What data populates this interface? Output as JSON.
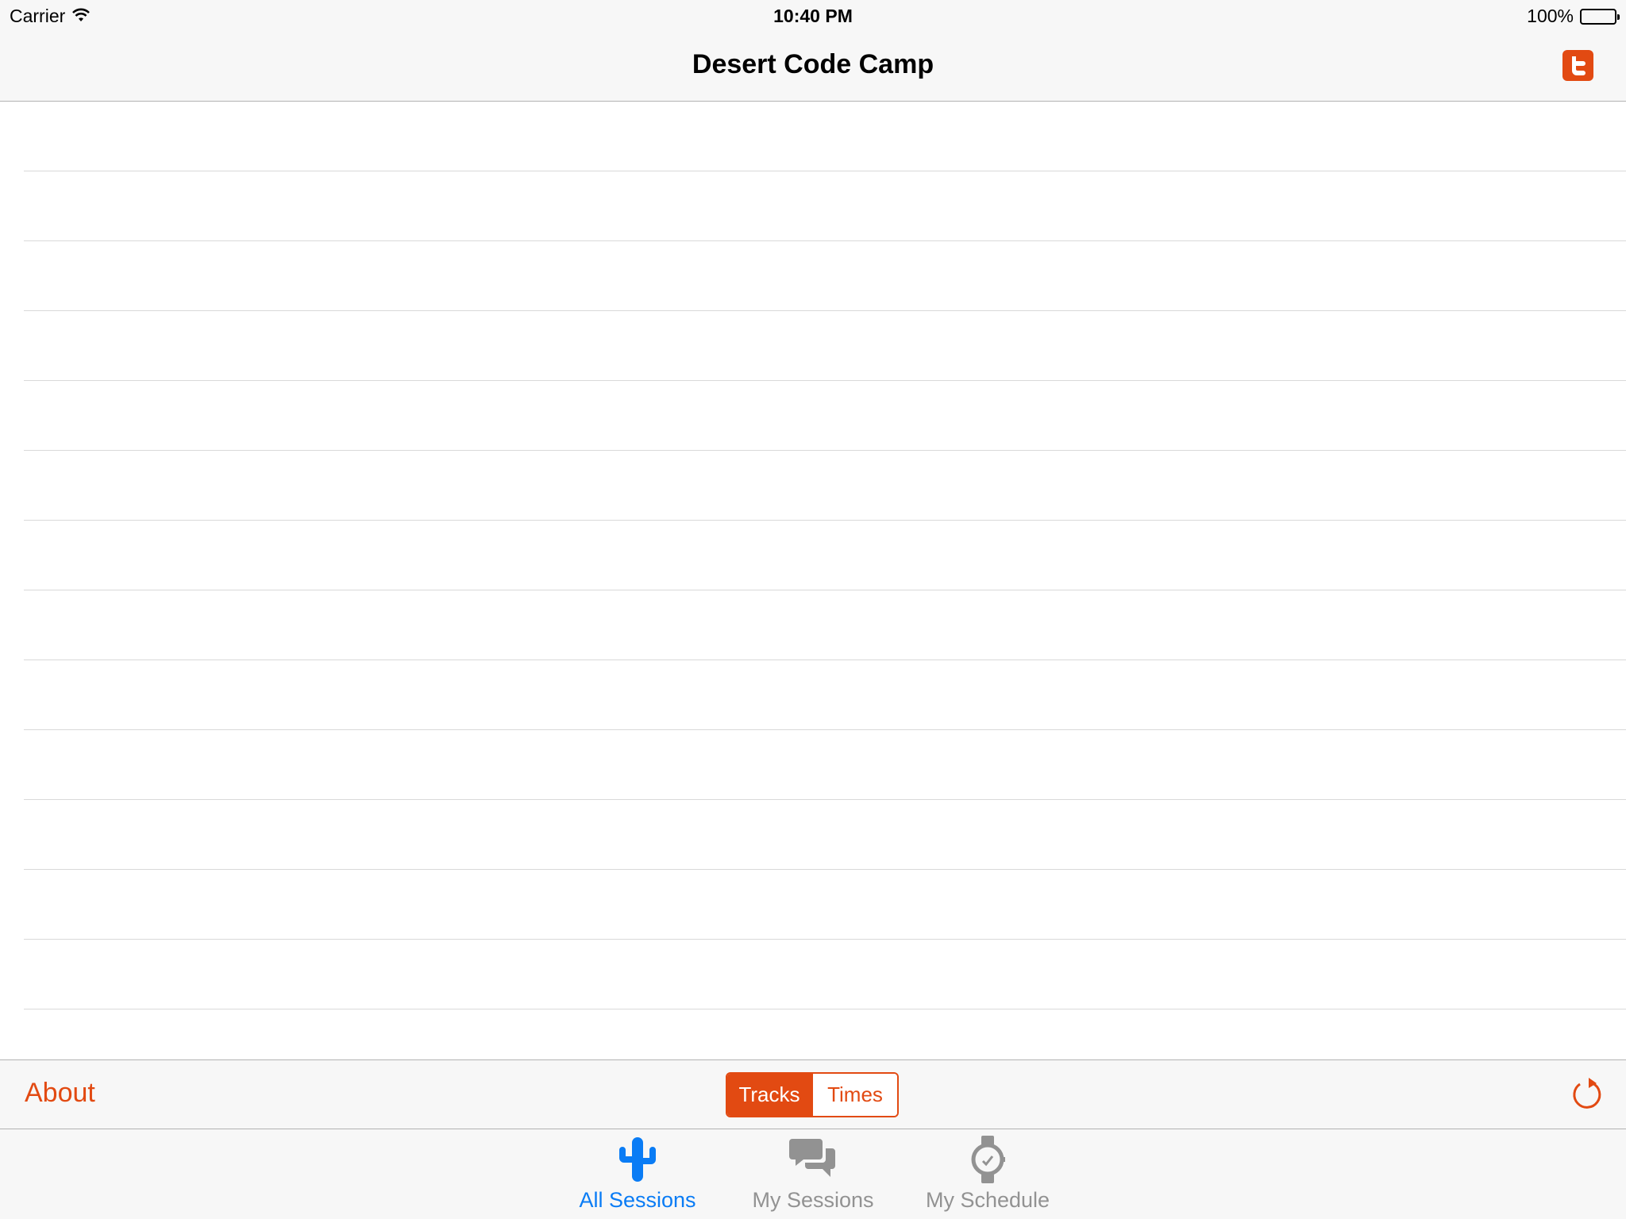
{
  "status_bar": {
    "carrier": "Carrier",
    "time": "10:40 PM",
    "battery": "100%"
  },
  "nav": {
    "title": "Desert Code Camp",
    "twitter_icon": "twitter-icon"
  },
  "list": {
    "row_count": 13
  },
  "toolbar": {
    "about_label": "About",
    "segments": [
      "Tracks",
      "Times"
    ],
    "selected_segment": "Tracks",
    "refresh_icon": "refresh-icon"
  },
  "tabs": [
    {
      "label": "All Sessions",
      "icon": "cactus-icon",
      "active": true
    },
    {
      "label": "My Sessions",
      "icon": "chat-bubbles-icon",
      "active": false
    },
    {
      "label": "My Schedule",
      "icon": "watch-icon",
      "active": false
    }
  ],
  "colors": {
    "accent": "#e24a12",
    "tab_active": "#0a7cf5",
    "tab_inactive": "#929292",
    "bar_background": "#f7f7f7"
  }
}
